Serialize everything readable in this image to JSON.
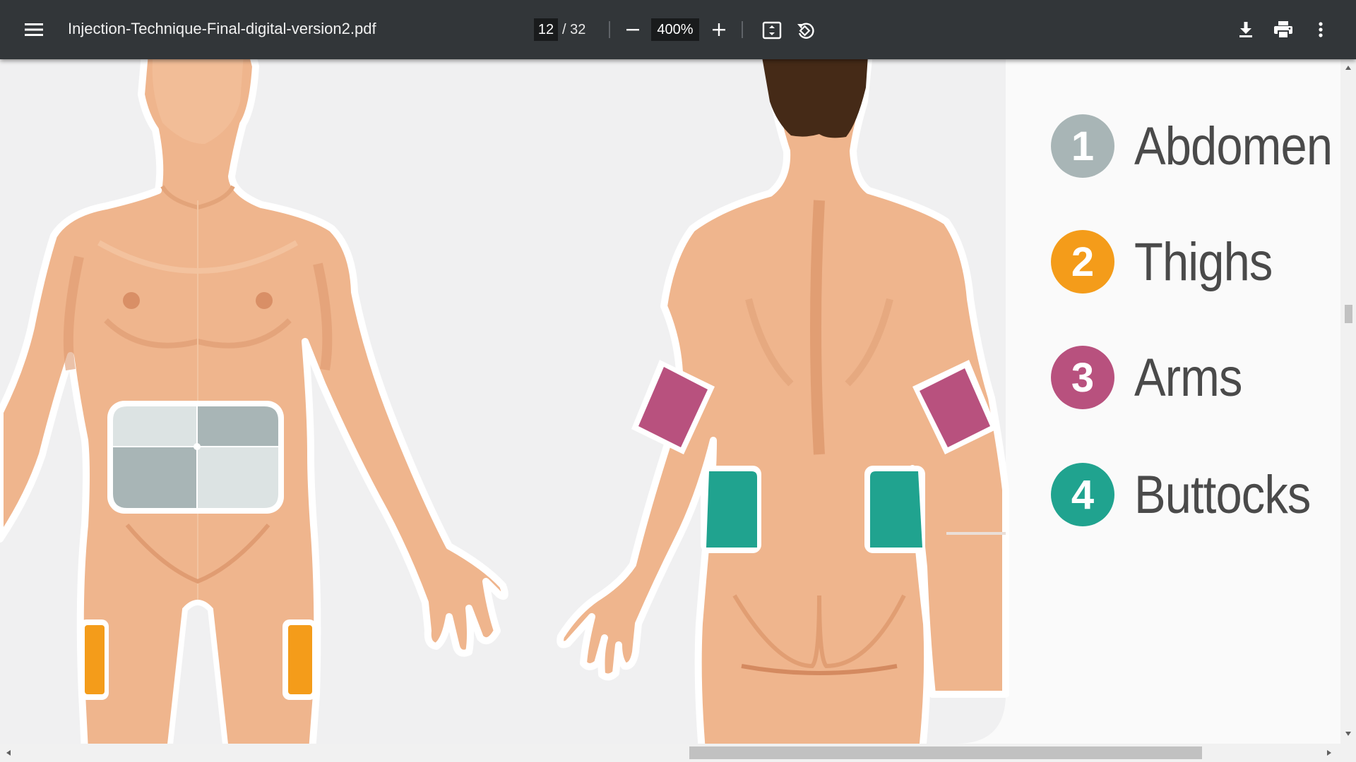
{
  "toolbar": {
    "file_name": "Injection-Technique-Final-digital-version2.pdf",
    "current_page": "12",
    "total_pages": "/ 32",
    "zoom": "400%"
  },
  "legend": [
    {
      "number": "1",
      "label": "Abdomen",
      "color": "#a8b5b6"
    },
    {
      "number": "2",
      "label": "Thighs",
      "color": "#f49c1a"
    },
    {
      "number": "3",
      "label": "Arms",
      "color": "#b8517e"
    },
    {
      "number": "4",
      "label": "Buttocks",
      "color": "#20a38f"
    }
  ],
  "colors": {
    "toolbar": "#323639",
    "skin": "#efb58d",
    "skin_shadow": "#df9a6f",
    "hair": "#452a17",
    "panel": "#f0f0f1"
  },
  "icons": [
    "menu-icon",
    "zoom-out-icon",
    "zoom-in-icon",
    "fit-page-icon",
    "rotate-icon",
    "download-icon",
    "print-icon",
    "more-options-icon"
  ]
}
